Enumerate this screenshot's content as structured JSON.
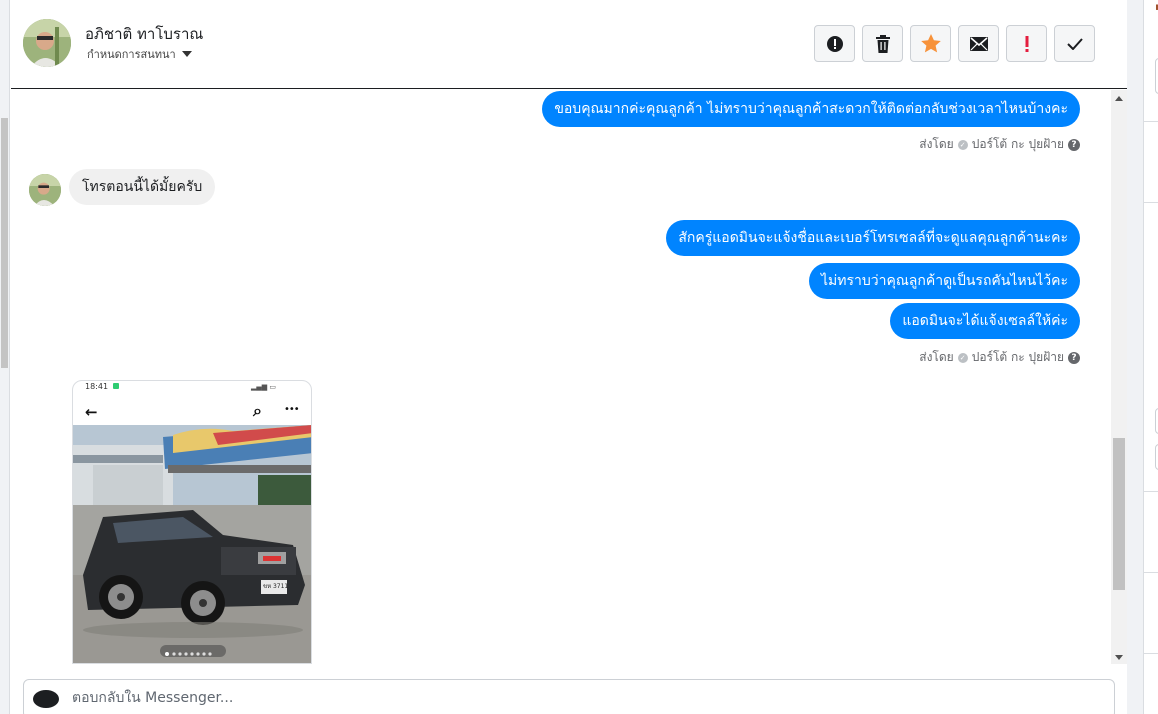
{
  "header": {
    "contact_name": "อภิชาติ ทาโบราณ",
    "assign_label": "กำหนดการสนทนา",
    "tools": [
      {
        "name": "spam-icon",
        "label": "!"
      },
      {
        "name": "trash-icon"
      },
      {
        "name": "star-icon"
      },
      {
        "name": "mail-icon"
      },
      {
        "name": "priority-icon",
        "label": "!"
      },
      {
        "name": "check-icon"
      }
    ]
  },
  "messages": {
    "out_1": "ขอบคุณมากค่ะคุณลูกค้า ไม่ทราบว่าคุณลูกค้าสะดวกให้ติดต่อกลับช่วงเวลาไหนบ้างคะ",
    "sent_by_1": "ส่งโดย",
    "sender_1": "ปอร์โต้ กะ ปุยฝ้าย",
    "in_1": "โทรตอนนี้ได้มั้ยครับ",
    "out_2": "สักครู่แอดมินจะแจ้งชื่อและเบอร์โทรเซลล์ที่จะดูแลคุณลูกค้านะคะ",
    "out_3": "ไม่ทราบว่าคุณลูกค้าดูเป็นรถคันไหนไว้คะ",
    "out_4": "แอดมินจะได้แจ้งเซลล์ให้ค่ะ",
    "sent_by_2": "ส่งโดย",
    "sender_2": "ปอร์โต้ กะ ปุยฝ้าย",
    "help_glyph": "?"
  },
  "attachment": {
    "status_time": "18:41",
    "back_glyph": "←",
    "search_glyph": "⌕",
    "more_glyph": "•••",
    "plate_text": "ขห 3711"
  },
  "composer": {
    "placeholder": "ตอบกลับใน Messenger..."
  },
  "colors": {
    "outgoing": "#0084ff",
    "incoming": "#f0f0f0",
    "star": "#f7923a",
    "priority": "#e41e3f"
  }
}
